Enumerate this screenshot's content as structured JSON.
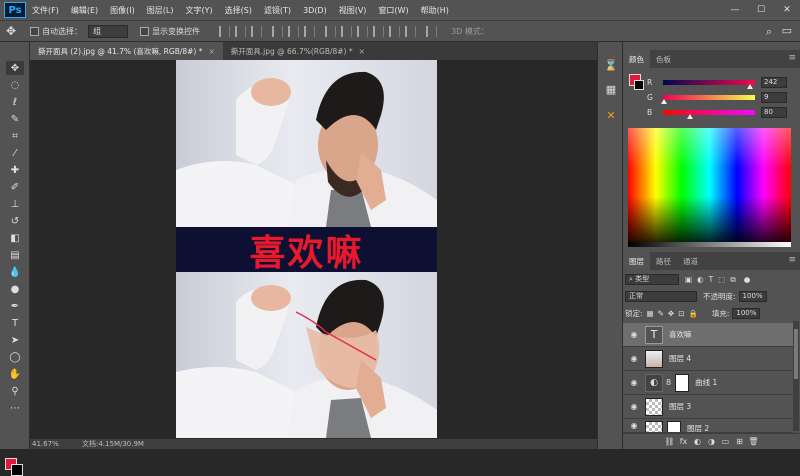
{
  "app": {
    "logo": "Ps"
  },
  "menu": [
    "文件(F)",
    "编辑(E)",
    "图像(I)",
    "图层(L)",
    "文字(Y)",
    "选择(S)",
    "滤镜(T)",
    "3D(D)",
    "视图(V)",
    "窗口(W)",
    "帮助(H)"
  ],
  "window_controls": [
    "—",
    "☐",
    "✕"
  ],
  "options": {
    "move_icon": "✥",
    "auto_select_label": "自动选择：",
    "auto_select_value": "组",
    "show_transform_label": "显示变换控件",
    "mode_3d_label": "3D 模式：",
    "search_icon": "⌕",
    "workspace_icon": "▭"
  },
  "tabs": [
    {
      "label": "撕开面具 (2).jpg @ 41.7% (喜欢嘛, RGB/8#) *",
      "close": "×"
    },
    {
      "label": "撕开面具.jpg @ 66.7%(RGB/8#) *",
      "close": "×"
    }
  ],
  "canvas": {
    "banner_text": "喜欢嘛"
  },
  "status": {
    "zoom": "41.67%",
    "doc_info": "文档:4.15M/30.9M"
  },
  "color_panel": {
    "tabs": [
      "颜色",
      "色板"
    ],
    "menu_icon": "≡",
    "foreground": "#e0173f",
    "r_label": "R",
    "r_value": "242",
    "r_level": 0.95,
    "g_label": "G",
    "g_value": "9",
    "g_level": 0.04,
    "b_label": "B",
    "b_value": "80",
    "b_level": 0.31
  },
  "layers_panel": {
    "tabs": [
      "图层",
      "路径",
      "通道"
    ],
    "menu_icon": "≡",
    "filter_label": "类型",
    "blend_mode": "正常",
    "opacity_label": "不透明度:",
    "opacity_value": "100%",
    "lock_label": "锁定:",
    "fill_label": "填充:",
    "fill_value": "100%",
    "eye_icon": "◉",
    "layers": [
      {
        "name": "喜欢嘛",
        "thumb": "T",
        "selected": true
      },
      {
        "name": "图层 4",
        "thumb": ""
      },
      {
        "name": "曲线 1",
        "thumb": "◐"
      },
      {
        "name": "图层 3",
        "thumb": ""
      },
      {
        "name": "图层 2",
        "thumb": ""
      }
    ],
    "footer_icons": [
      "⛓",
      "fx",
      "◐",
      "◑",
      "▭",
      "⊞",
      "🗑"
    ]
  }
}
